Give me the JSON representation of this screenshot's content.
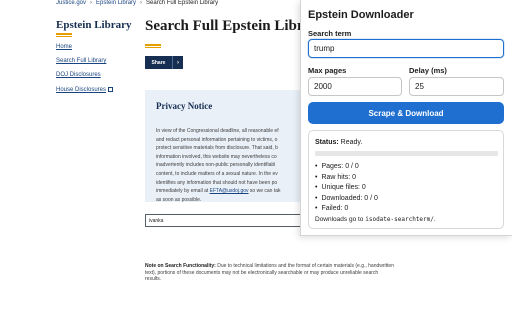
{
  "website": {
    "breadcrumbs": [
      "Justice.gov",
      "Epstein Library",
      "Search Full Epstein Library"
    ],
    "library_title": "Epstein Library",
    "sidebar": [
      {
        "label": "Home",
        "external": false
      },
      {
        "label": "Search Full Library",
        "external": false
      },
      {
        "label": "DOJ Disclosures",
        "external": false
      },
      {
        "label": "House Disclosures",
        "external": true
      }
    ],
    "page_title": "Search Full Epstein Libra",
    "share_label": "Share",
    "privacy": {
      "title": "Privacy Notice",
      "lines": [
        "In view of the Congressional deadline, all reasonable ef",
        "and redact personal information pertaining to victims, o",
        "protect sensitive materials from disclosure. That said, b",
        "information involved, this website may nevertheless co",
        "inadvertently includes non-public personally identifiabl",
        "content, to include matters of a sexual nature. In the ev"
      ],
      "line7_pre": "identifies any information that should not have been po",
      "line8_pre": "immediately by email at ",
      "email": "EFTA@usdoj.gov",
      "line8_post": " so we can tak",
      "line9": "as soon as possible."
    },
    "search_value": "ivanka",
    "note_label": "Note on Search Functionality:",
    "note_text": " Due to technical limitations and the format of certain materials (e.g., handwritten text), portions of these documents may not be electronically searchable or may produce unreliable search results."
  },
  "popup": {
    "title": "Epstein Downloader",
    "search_term_label": "Search term",
    "search_term_value": "trump",
    "max_pages_label": "Max pages",
    "max_pages_value": "2000",
    "delay_label": "Delay (ms)",
    "delay_value": "25",
    "button_label": "Scrape & Download",
    "status_label": "Status:",
    "status_value": " Ready.",
    "progress_fraction": 0,
    "stats": [
      "Pages: 0 / 0",
      "Raw hits: 0",
      "Unique files: 0",
      "Downloaded: 0 / 0",
      "Failed: 0"
    ],
    "downloads_pre": "Downloads go to ",
    "downloads_path": "isodate-searchterm/",
    "downloads_post": "."
  },
  "colors": {
    "accent_blue": "#1f6fd1",
    "navy": "#162e51",
    "gold": "#e5a000",
    "link": "#1a4480",
    "notice_bg": "#e9f0f8"
  }
}
